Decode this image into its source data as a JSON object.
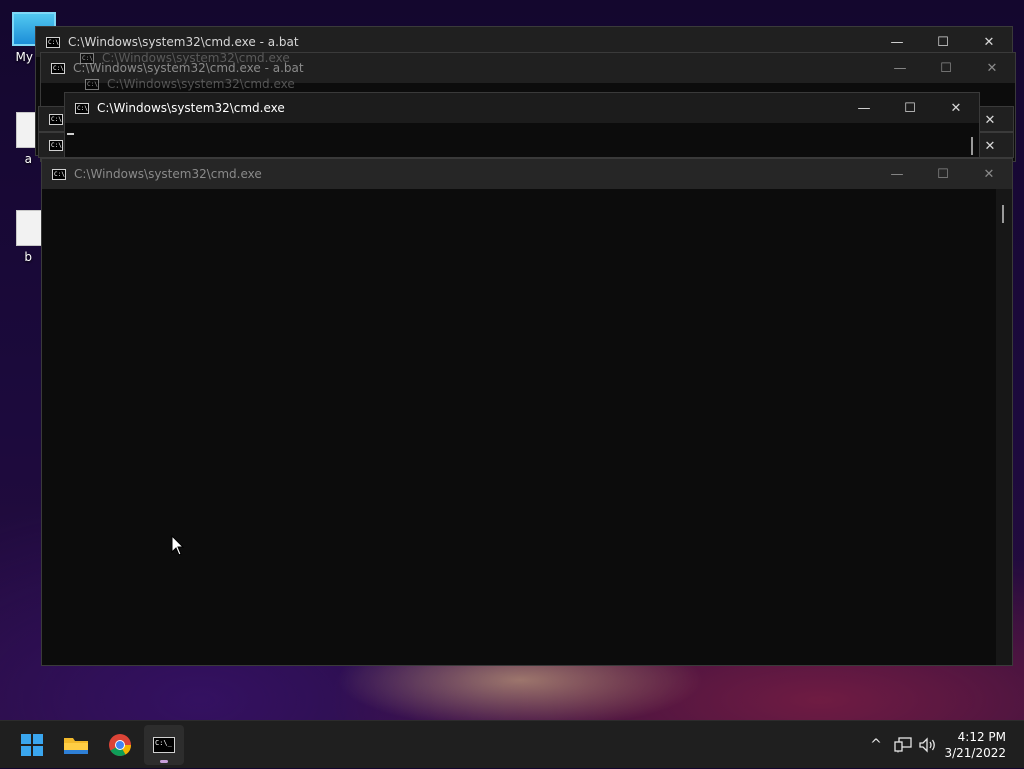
{
  "desktop": {
    "icons": [
      {
        "label": "My Co",
        "icon": "computer-icon"
      },
      {
        "label": "a",
        "icon": "file-icon"
      },
      {
        "label": "b",
        "icon": "file-icon"
      }
    ]
  },
  "windows": {
    "back_1": {
      "title": "C:\\Windows\\system32\\cmd.exe - a.bat"
    },
    "back_2": {
      "title": "C:\\Windows\\system32\\cmd.exe - a.bat"
    },
    "back_3": {
      "title": "C:\\Windows\\system32\\cmd.exe"
    },
    "back_4": {
      "title": "C:\\Windows\\system32\\cmd.exe"
    },
    "middle": {
      "title": "C:\\Windows\\system32\\cmd.exe"
    },
    "front": {
      "title": "C:\\Windows\\system32\\cmd.exe"
    }
  },
  "controls": {
    "minimize": "—",
    "maximize": "☐",
    "close": "✕"
  },
  "taskbar": {
    "apps": [
      "start-icon",
      "file-explorer-icon",
      "chrome-icon",
      "cmd-icon"
    ],
    "tray": {
      "chevron": "^",
      "network": "network-icon",
      "volume": "speaker-icon"
    },
    "time": "4:12 PM",
    "date": "3/21/2022"
  }
}
